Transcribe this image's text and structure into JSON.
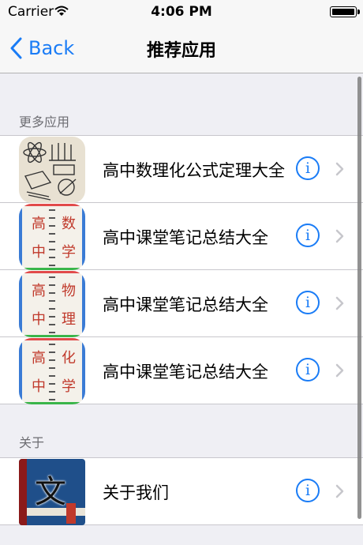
{
  "status_bar": {
    "carrier": "Carrier",
    "time": "4:06 PM"
  },
  "nav": {
    "back_label": "Back",
    "title": "推荐应用"
  },
  "sections": [
    {
      "header": "更多应用",
      "items": [
        {
          "label": "高中数理化公式定理大全",
          "icon": "science-sketch-app-icon"
        },
        {
          "label": "高中课堂笔记总结大全",
          "icon": "notebook-math-app-icon",
          "badge": [
            "高",
            "中",
            "数",
            "学"
          ]
        },
        {
          "label": "高中课堂笔记总结大全",
          "icon": "notebook-physics-app-icon",
          "badge": [
            "高",
            "中",
            "物",
            "理"
          ]
        },
        {
          "label": "高中课堂笔记总结大全",
          "icon": "notebook-chemistry-app-icon",
          "badge": [
            "高",
            "中",
            "化",
            "学"
          ]
        }
      ]
    },
    {
      "header": "关于",
      "items": [
        {
          "label": "关于我们",
          "icon": "book-wen-app-icon",
          "badge": [
            "文"
          ]
        }
      ]
    }
  ],
  "colors": {
    "accent": "#1a7cf6",
    "background": "#efeff4"
  }
}
